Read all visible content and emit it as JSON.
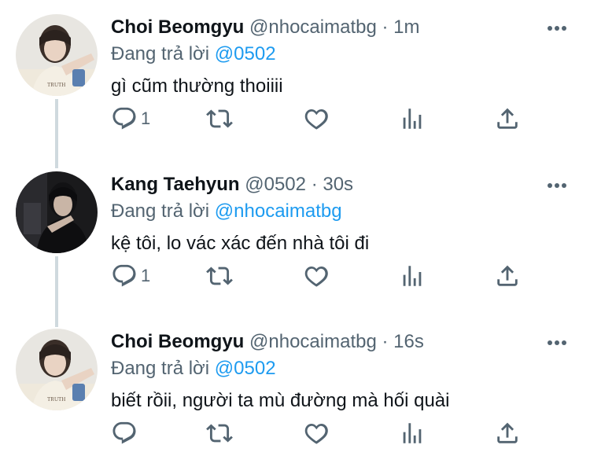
{
  "colors": {
    "name": "#0f1419",
    "secondary": "#536471",
    "link": "#1d9bf0",
    "thread_line": "#cfd9de"
  },
  "tweets": [
    {
      "name": "Choi Beomgyu",
      "handle": "@nhocaimatbg",
      "separator": "·",
      "time": "1m",
      "reply_prefix": "Đang trả lời",
      "reply_to": "@0502",
      "text": "gì cũm thường thoiiii",
      "reply_count": "1",
      "avatar": "avatar-beomgyu"
    },
    {
      "name": "Kang Taehyun",
      "handle": "@0502",
      "separator": "·",
      "time": "30s",
      "reply_prefix": "Đang trả lời",
      "reply_to": "@nhocaimatbg",
      "text": "kệ tôi, lo vác xác đến nhà tôi đi",
      "reply_count": "1",
      "avatar": "avatar-taehyun"
    },
    {
      "name": "Choi Beomgyu",
      "handle": "@nhocaimatbg",
      "separator": "·",
      "time": "16s",
      "reply_prefix": "Đang trả lời",
      "reply_to": "@0502",
      "text": "biết rồii, người ta mù đường mà hối quài",
      "reply_count": "",
      "avatar": "avatar-beomgyu"
    }
  ],
  "icons": [
    "more-icon",
    "reply-icon",
    "retweet-icon",
    "like-icon",
    "views-icon",
    "share-icon"
  ]
}
